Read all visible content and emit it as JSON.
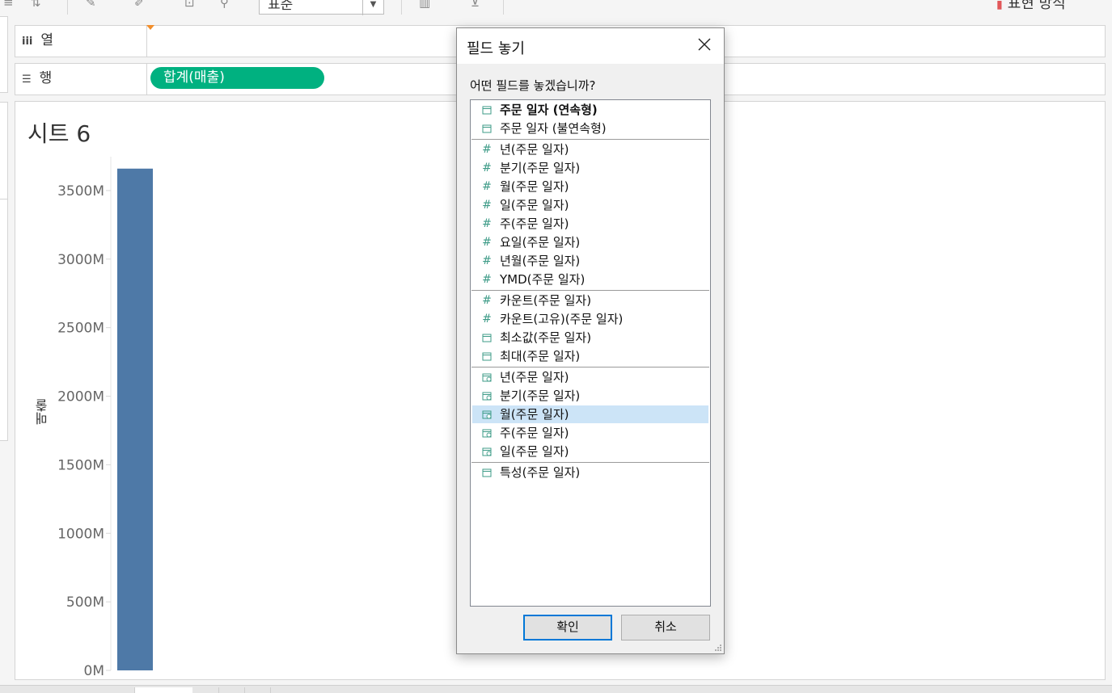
{
  "toolbar": {
    "fit_value": "표준",
    "show_me_label": "표현 방식"
  },
  "shelves": {
    "columns_label": "열",
    "rows_label": "행",
    "rows_pill": "합계(매출)"
  },
  "sheet": {
    "title": "시트 6",
    "y_axis_title": "매출"
  },
  "chart_data": {
    "type": "bar",
    "title": "시트 6",
    "xlabel": "",
    "ylabel": "매출",
    "categories": [
      ""
    ],
    "values": [
      3660
    ],
    "value_unit": "M",
    "ylim": [
      0,
      3800
    ],
    "yticks": [
      0,
      500,
      1000,
      1500,
      2000,
      2500,
      3000,
      3500
    ],
    "ytick_labels": [
      "0M",
      "500M",
      "1000M",
      "1500M",
      "2000M",
      "2500M",
      "3000M",
      "3500M"
    ],
    "bar_color": "#4e79a7",
    "grid": false
  },
  "dialog": {
    "title": "필드 놓기",
    "question": "어떤 필드를 놓겠습니까?",
    "ok_label": "확인",
    "cancel_label": "취소",
    "groups": [
      [
        {
          "label": "주문 일자 (연속형)",
          "icon": "calendar-icon",
          "bold": true
        },
        {
          "label": "주문 일자 (불연속형)",
          "icon": "calendar-icon"
        }
      ],
      [
        {
          "label": "년(주문 일자)",
          "icon": "hash-icon"
        },
        {
          "label": "분기(주문 일자)",
          "icon": "hash-icon"
        },
        {
          "label": "월(주문 일자)",
          "icon": "hash-icon"
        },
        {
          "label": "일(주문 일자)",
          "icon": "hash-icon"
        },
        {
          "label": "주(주문 일자)",
          "icon": "hash-icon"
        },
        {
          "label": "요일(주문 일자)",
          "icon": "hash-icon"
        },
        {
          "label": "년월(주문 일자)",
          "icon": "hash-icon"
        },
        {
          "label": "YMD(주문 일자)",
          "icon": "hash-icon"
        }
      ],
      [
        {
          "label": "카운트(주문 일자)",
          "icon": "hash-icon"
        },
        {
          "label": "카운트(고유)(주문 일자)",
          "icon": "hash-icon"
        },
        {
          "label": "최소값(주문 일자)",
          "icon": "calendar-icon"
        },
        {
          "label": "최대(주문 일자)",
          "icon": "calendar-icon"
        }
      ],
      [
        {
          "label": "년(주문 일자)",
          "icon": "calendar-clock-icon"
        },
        {
          "label": "분기(주문 일자)",
          "icon": "calendar-clock-icon"
        },
        {
          "label": "월(주문 일자)",
          "icon": "calendar-clock-icon",
          "selected": true
        },
        {
          "label": "주(주문 일자)",
          "icon": "calendar-clock-icon"
        },
        {
          "label": "일(주문 일자)",
          "icon": "calendar-clock-icon"
        }
      ],
      [
        {
          "label": "특성(주문 일자)",
          "icon": "calendar-icon"
        }
      ]
    ]
  }
}
